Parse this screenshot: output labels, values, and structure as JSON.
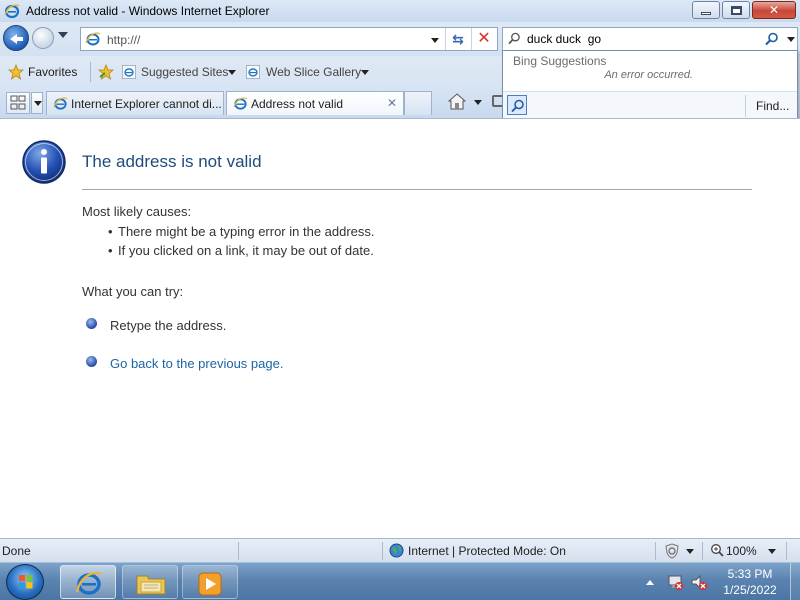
{
  "window": {
    "title": "Address not valid - Windows Internet Explorer"
  },
  "address_bar": {
    "url": "http:///"
  },
  "search": {
    "value": "duck duck  go",
    "provider_header": "Bing Suggestions",
    "error_message": "An error occurred.",
    "find_label": "Find..."
  },
  "favorites_bar": {
    "favorites_label": "Favorites",
    "suggested_sites_label": "Suggested Sites",
    "web_slice_label": "Web Slice Gallery"
  },
  "tabs": [
    {
      "label": "Internet Explorer cannot di...",
      "active": false
    },
    {
      "label": "Address not valid",
      "active": true
    }
  ],
  "page": {
    "heading": "The address is not valid",
    "causes_heading": "Most likely causes:",
    "causes": [
      "There might be a typing error in the address.",
      "If you clicked on a link, it may be out of date."
    ],
    "try_heading": "What you can try:",
    "try_items": [
      "Retype the address.",
      "Go back to the previous page."
    ]
  },
  "status_bar": {
    "status": "Done",
    "zone": "Internet | Protected Mode: On",
    "zoom": "100%"
  },
  "taskbar": {
    "time": "5:33 PM",
    "date": "1/25/2022"
  },
  "colors": {
    "heading": "#1f4b7d",
    "link": "#1c64a4",
    "close_button": "#c7463a"
  },
  "icons": [
    "ie-icon",
    "back-arrow-icon",
    "forward-arrow-icon",
    "compatibility-view-icon",
    "stop-icon",
    "search-icon",
    "favorites-star-icon",
    "add-favorites-icon",
    "quick-tabs-icon",
    "home-icon",
    "info-icon",
    "globe-icon",
    "shield-icon",
    "zoom-icon",
    "windows-flag-icon",
    "folder-icon",
    "media-player-icon",
    "network-icon",
    "volume-muted-icon"
  ]
}
